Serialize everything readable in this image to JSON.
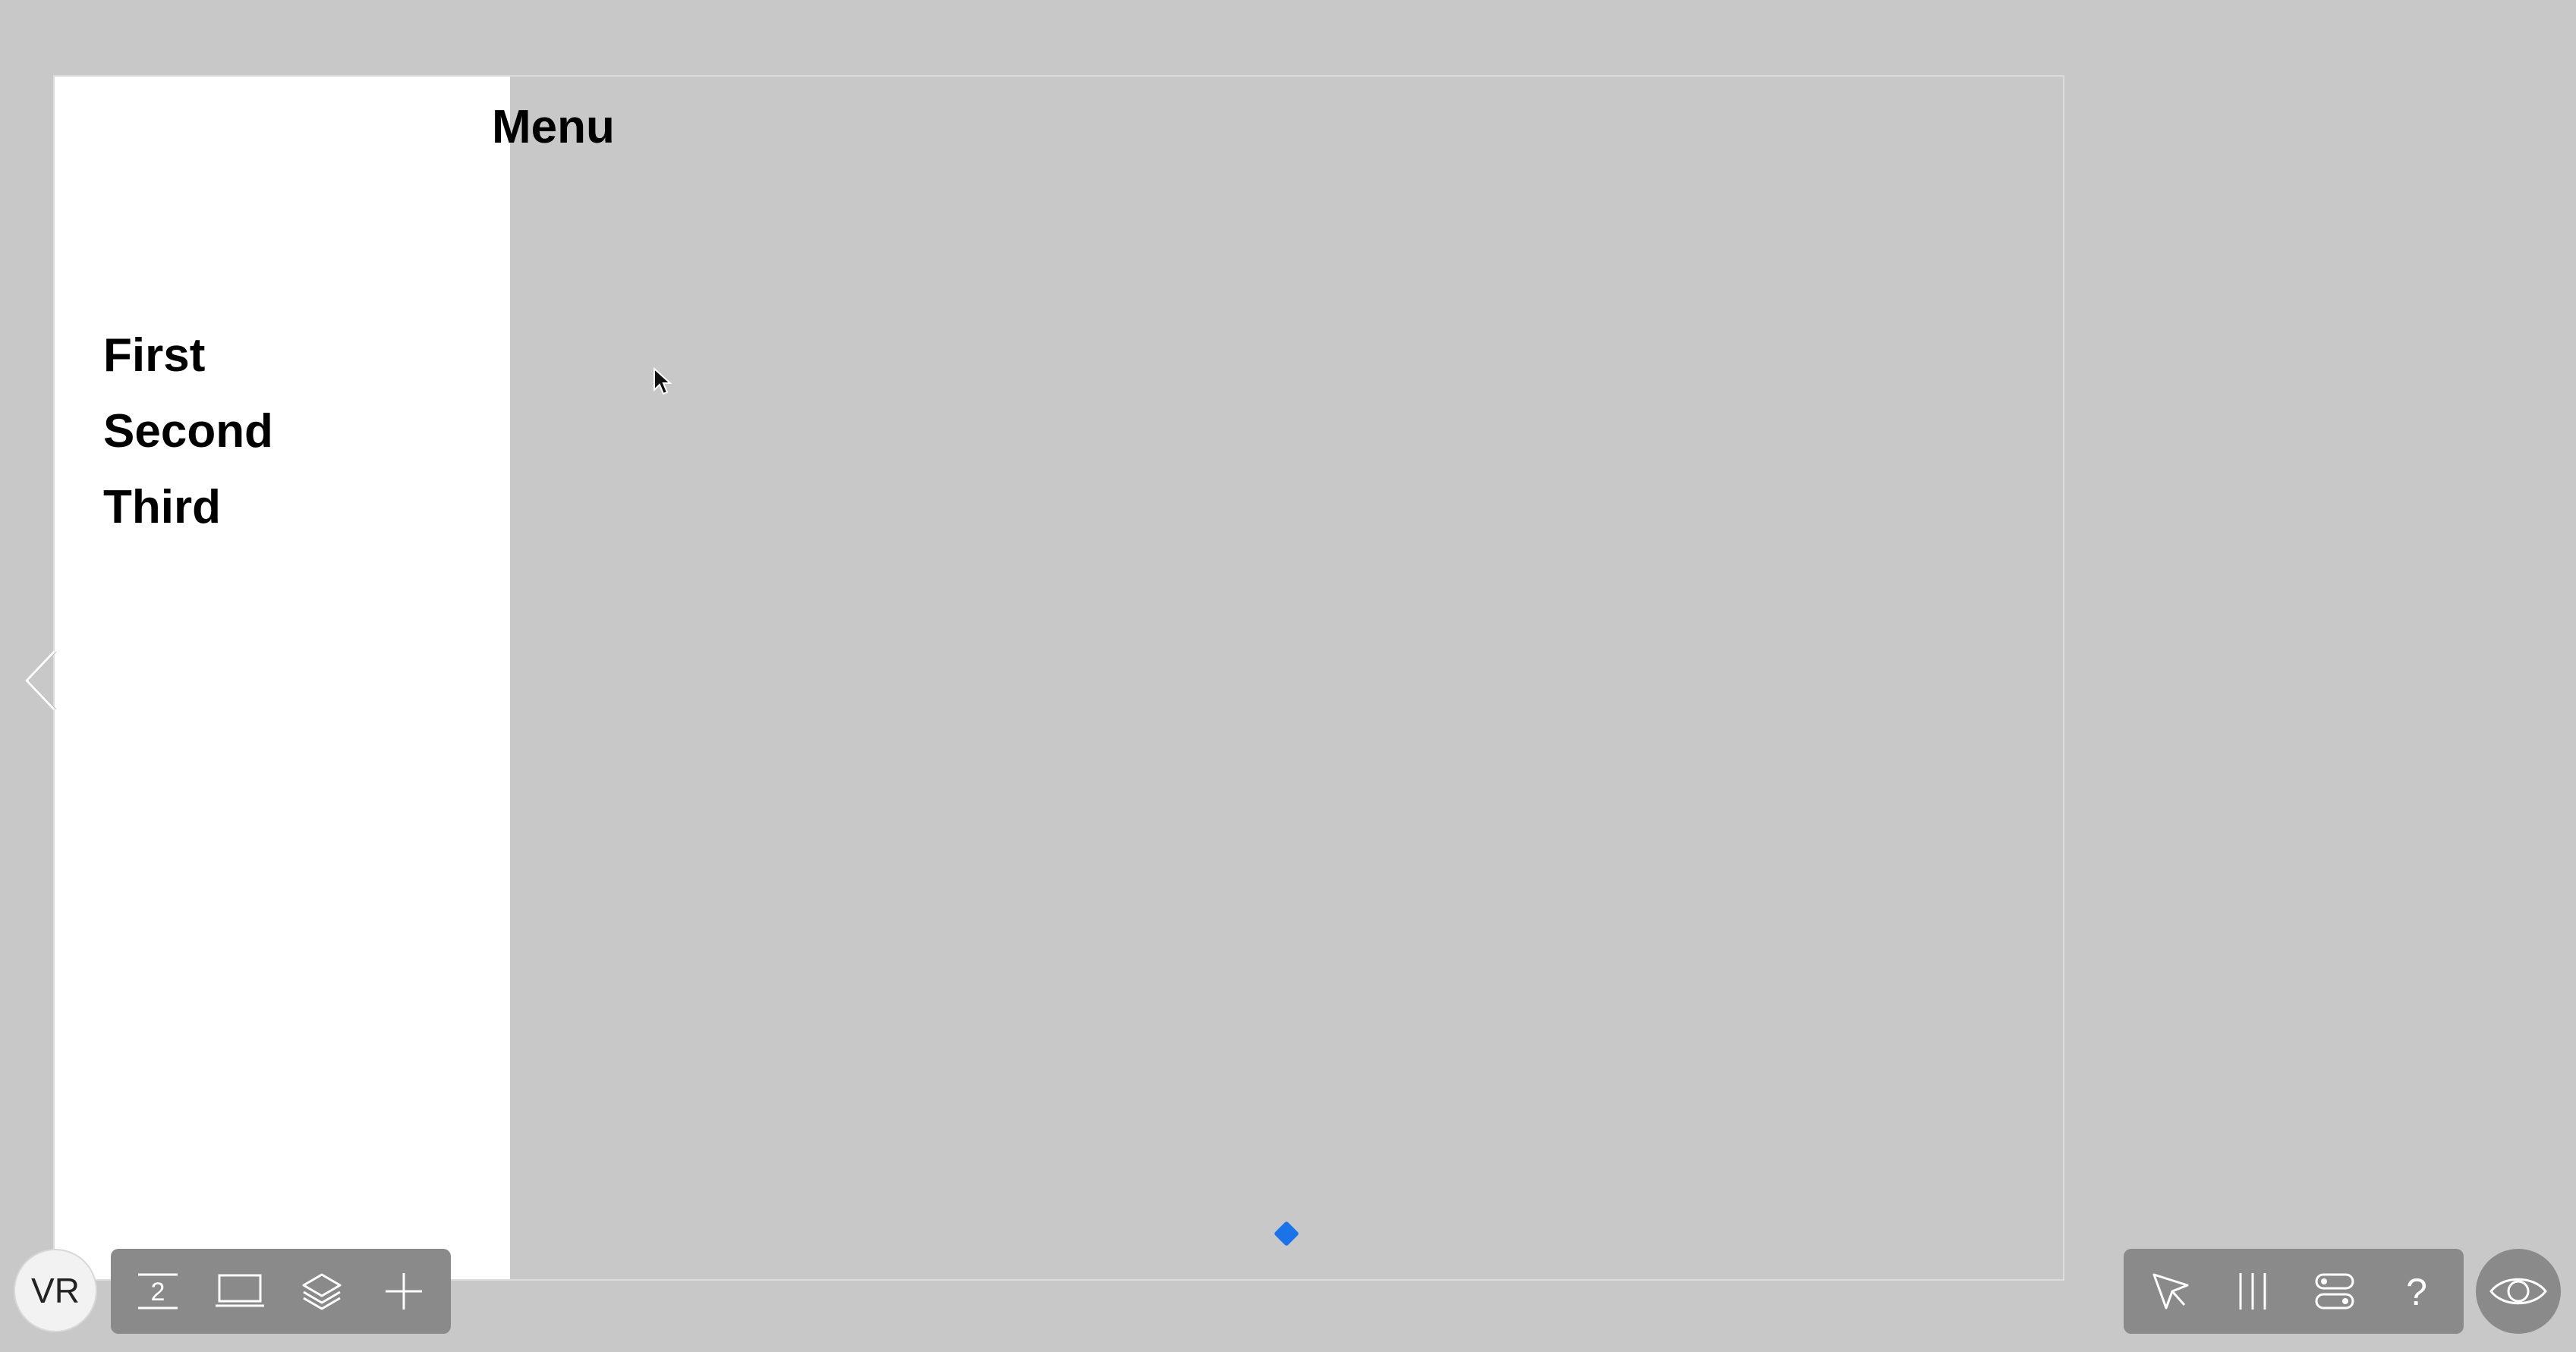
{
  "user": {
    "initials": "VR"
  },
  "sidebar": {
    "items": [
      {
        "label": "First"
      },
      {
        "label": "Second"
      },
      {
        "label": "Third"
      }
    ]
  },
  "main": {
    "title": "Menu"
  },
  "left_toolbar": {
    "tools": [
      "page-number-icon",
      "device-frame-icon",
      "layers-icon",
      "add-icon"
    ],
    "page_number": "2"
  },
  "right_toolbar": {
    "tools": [
      "pointer-icon",
      "columns-icon",
      "toggles-icon",
      "help-icon"
    ],
    "help_glyph": "?"
  },
  "colors": {
    "accent": "#1a73e8",
    "background": "#c8c8c8",
    "sidebar": "#ffffff",
    "toolbar": "#8a8a8a"
  }
}
